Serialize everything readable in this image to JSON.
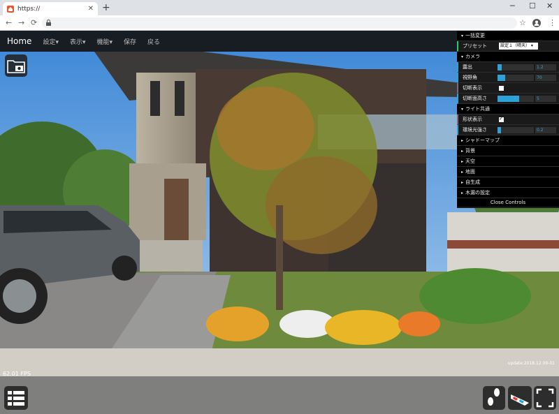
{
  "browser": {
    "tab_title": "https://",
    "new_tab": "+",
    "minimize": "─",
    "maximize": "☐",
    "close": "✕",
    "back": "←",
    "forward": "→",
    "reload": "⟳",
    "star": "☆",
    "menu": "⋮",
    "tab_close": "✕"
  },
  "appbar": {
    "brand": "Home",
    "items": [
      "設定▾",
      "表示▾",
      "機能▾",
      "保存",
      "戻る"
    ]
  },
  "gui": {
    "batch_folder": "一括変更",
    "preset_label": "プリセット",
    "preset_value": "設定１（晴天）",
    "camera_folder": "カメラ",
    "exposure_label": "露出",
    "exposure_value": "1.2",
    "exposure_fraction": 0.12,
    "fov_label": "視野角",
    "fov_value": "70",
    "fov_fraction": 0.22,
    "section_view_label": "切断表示",
    "section_view_checked": false,
    "section_height_label": "切断面高さ",
    "section_height_value": "5",
    "section_height_fraction": 0.6,
    "light_folder": "ライト共通",
    "shape_display_label": "形状表示",
    "shape_display_checked": true,
    "ambient_label": "環境光強さ",
    "ambient_value": "0.2",
    "ambient_fraction": 0.1,
    "shadow_folder": "シャドーマップ",
    "background_folder": "背景",
    "sky_folder": "天空",
    "ground_folder": "地面",
    "auto_generate_folder": "自生成",
    "tree_folder": "木漏の設定",
    "close_controls": "Close Controls"
  },
  "overlay": {
    "fps": "62.01 FPS",
    "update": "update:2018.12.09-01"
  },
  "icons": {
    "folder_camera": "folder-camera-icon",
    "list": "list-icon",
    "footsteps": "footsteps-icon",
    "vr_glasses": "vr-glasses-icon",
    "fullscreen": "fullscreen-icon"
  },
  "colors": {
    "accent": "#2fa1d6",
    "select_accent": "#1ed36f",
    "checkbox_accent": "#806787"
  }
}
